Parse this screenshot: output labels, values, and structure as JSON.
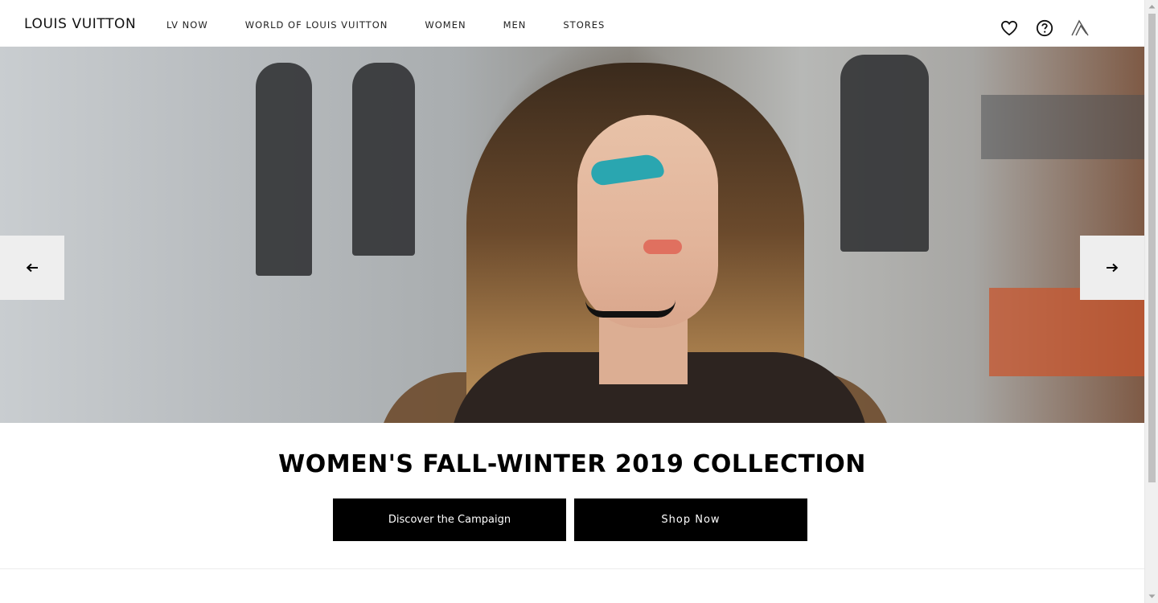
{
  "header": {
    "logo": "LOUIS VUITTON",
    "nav": [
      "LV NOW",
      "WORLD OF LOUIS VUITTON",
      "WOMEN",
      "MEN",
      "STORES"
    ],
    "icons": [
      "heart-icon",
      "help-icon",
      "account-icon"
    ]
  },
  "hero": {
    "image_subject": "",
    "prev_icon": "arrow-left-icon",
    "next_icon": "arrow-right-icon"
  },
  "campaign": {
    "headline": "WOMEN'S FALL-WINTER 2019 COLLECTION",
    "primary_cta": "Discover the Campaign",
    "secondary_cta": "Shop Now"
  },
  "colors": {
    "brand_black": "#000000",
    "button_text": "#ffffff",
    "arrow_bg": "#eeeeee"
  }
}
